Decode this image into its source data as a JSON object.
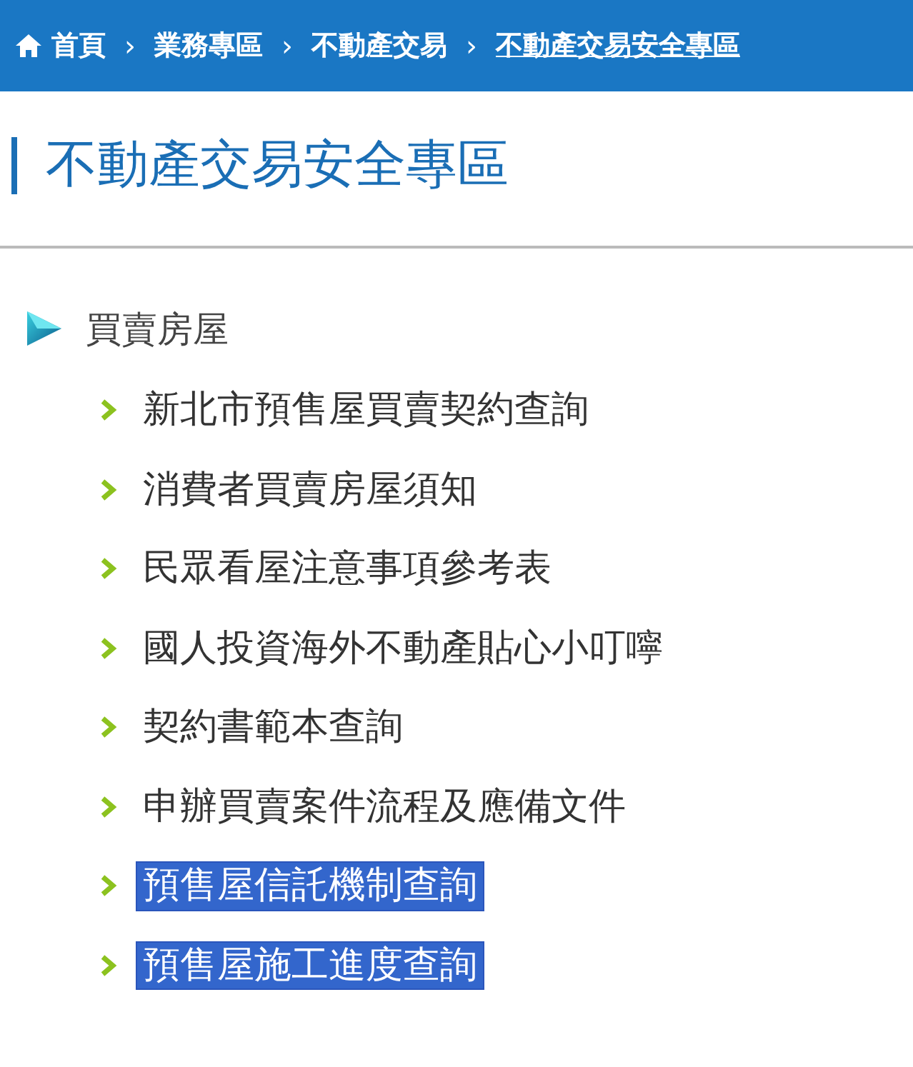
{
  "breadcrumb": [
    {
      "label": "首頁",
      "current": false
    },
    {
      "label": "業務專區",
      "current": false
    },
    {
      "label": "不動產交易",
      "current": false
    },
    {
      "label": "不動產交易安全專區",
      "current": true
    }
  ],
  "separator": "›",
  "page_title": "不動產交易安全專區",
  "section": {
    "title": "買賣房屋",
    "items": [
      {
        "label": "新北市預售屋買賣契約查詢",
        "selected": false
      },
      {
        "label": "消費者買賣房屋須知",
        "selected": false
      },
      {
        "label": "民眾看屋注意事項參考表",
        "selected": false
      },
      {
        "label": "國人投資海外不動產貼心小叮嚀",
        "selected": false
      },
      {
        "label": "契約書範本查詢",
        "selected": false
      },
      {
        "label": "申辦買賣案件流程及應備文件",
        "selected": false
      },
      {
        "label": "預售屋信託機制查詢",
        "selected": true
      },
      {
        "label": "預售屋施工進度查詢",
        "selected": true
      }
    ]
  }
}
